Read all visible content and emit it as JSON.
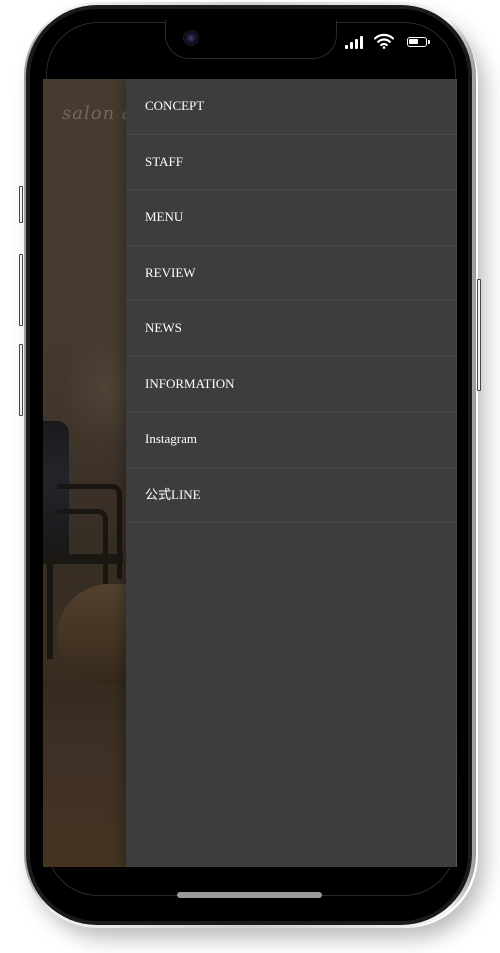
{
  "device": {
    "status_bar": {
      "signal_icon": "cellular-signal-icon",
      "wifi_icon": "wifi-icon",
      "battery_icon": "battery-icon"
    },
    "home_indicator": "home-indicator-bar"
  },
  "background": {
    "logo_text": "salon a",
    "image_description": "dim salon interior with chair and floor cushion"
  },
  "drawer": {
    "colors": {
      "background": "#3d3d3d",
      "text": "#ffffff",
      "divider": "#474747"
    },
    "items": [
      {
        "label": "CONCEPT"
      },
      {
        "label": "STAFF"
      },
      {
        "label": "MENU"
      },
      {
        "label": "REVIEW"
      },
      {
        "label": "NEWS"
      },
      {
        "label": "INFORMATION"
      },
      {
        "label": "Instagram"
      },
      {
        "label": "公式LINE"
      }
    ]
  }
}
